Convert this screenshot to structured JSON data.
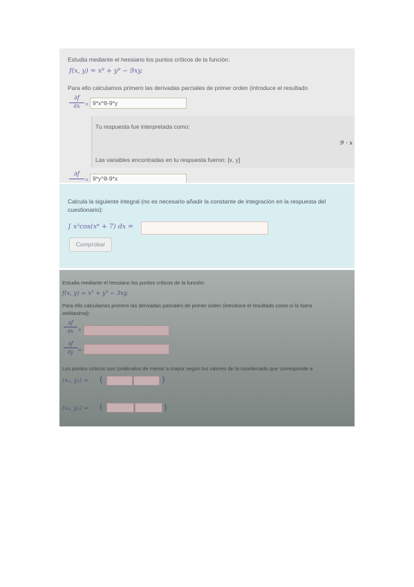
{
  "panel1": {
    "intro": "Estudia mediante el hessiano los puntos críticos de la función:",
    "function": "f(x, y) = x⁹ + y⁹ − 9xy.",
    "instruction": "Para ello calculamos primero las derivadas parciales de primer orden (introduce el resultado",
    "dfdx_num": "∂f",
    "dfdx_den": "∂x",
    "equals": "=",
    "dfdx_answer": "9*x^8-9*y",
    "feedback_interpreted": "Tu respuesta fue interpretada como:",
    "feedback_expr": "9 · x",
    "feedback_vars": "Las variables encontradas en tu respuesta fueron: [x, y]",
    "dfdy_num": "∂f",
    "dfdy_answer": "9*y^8-9*x"
  },
  "panel2": {
    "question": "Calcula la siguiente integral (no es necesario añadir la constante de integración en la respuesta del cuestionario):",
    "integral": "∫ x⁵cos(x⁶ + 7) dx =",
    "answer_value": "",
    "check_button": "Comprobar"
  },
  "panel3": {
    "intro": "Estudia mediante el hessiano los puntos críticos de la función:",
    "function": "f(x, y) = x³ + y³ − 3xy.",
    "instruction": "Para ello calculamos primero las derivadas parciales de primer orden (introduce el resultado como si lo fuera",
    "instruction_cont": "wxMaxima):",
    "dfdx_num": "∂f",
    "dfdx_den": "∂x",
    "dfdy_num": "∂f",
    "dfdy_den": "∂y",
    "equals": "=",
    "critical_points": "Los puntos críticos son (ordénalos de menor a mayor según los valores de la coordenada que corresponde a",
    "point1_label": "(x₁, y₁) =",
    "point2_label": "(x₂, y₂) =",
    "open_paren": "(",
    "close_paren": ")"
  }
}
